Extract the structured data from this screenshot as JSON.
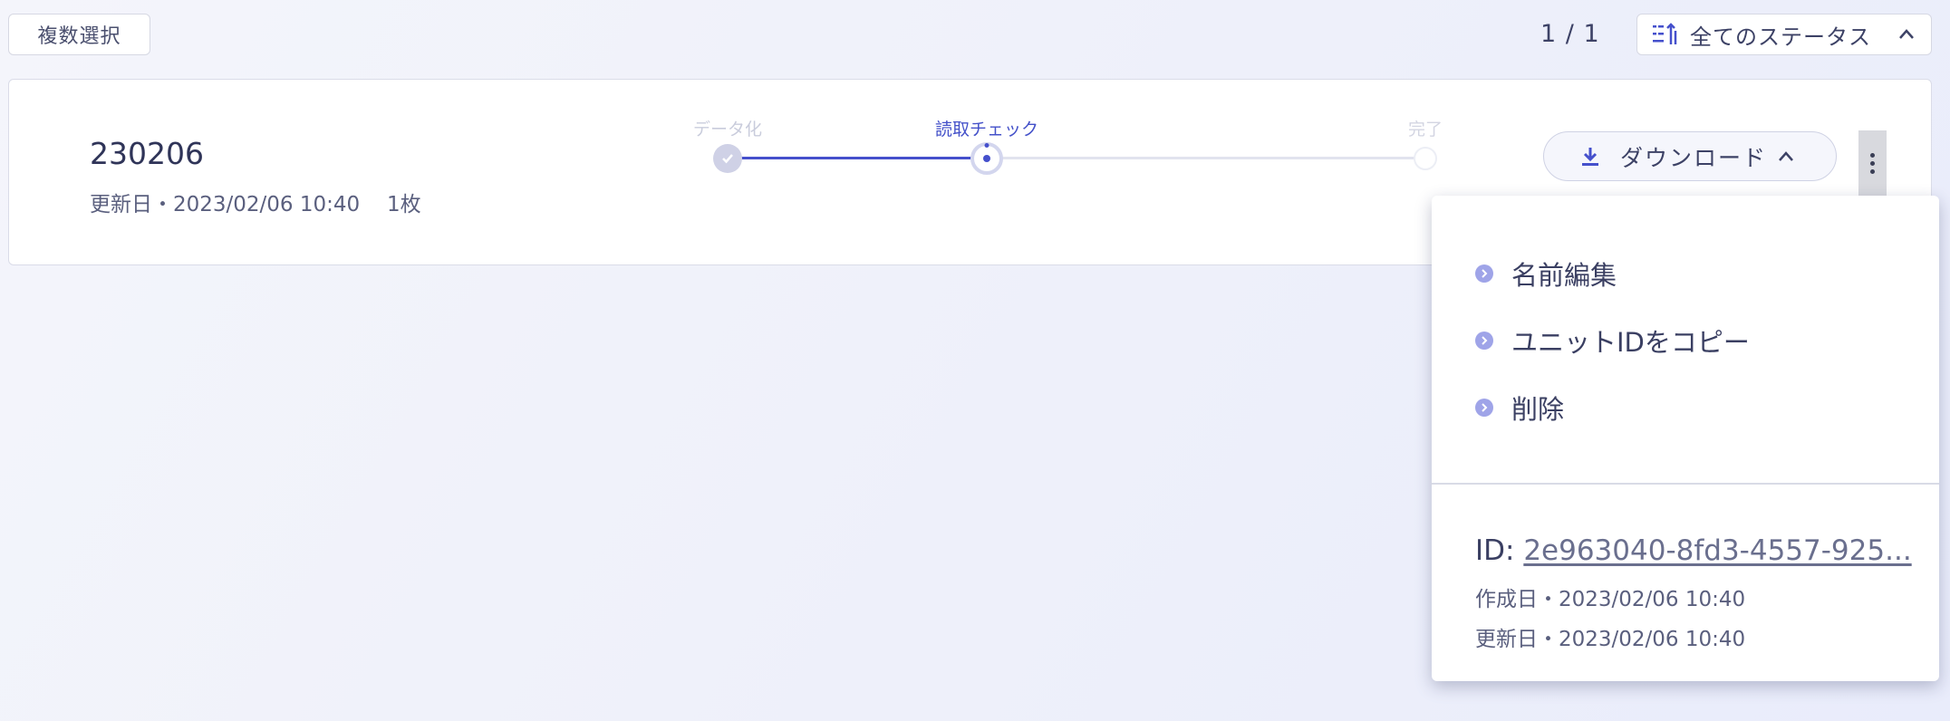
{
  "toolbar": {
    "multi_select_label": "複数選択",
    "pager": "1 / 1",
    "status_filter_label": "全てのステータス"
  },
  "unit": {
    "name": "230206",
    "updated": "更新日・2023/02/06 10:40",
    "count": "1枚",
    "steps": [
      {
        "label": "データ化",
        "state": "done"
      },
      {
        "label": "読取チェック",
        "state": "active"
      },
      {
        "label": "完了",
        "state": "todo"
      }
    ],
    "download_label": "ダウンロード"
  },
  "menu": {
    "items": [
      {
        "label": "名前編集"
      },
      {
        "label": "ユニットIDをコピー"
      },
      {
        "label": "削除"
      }
    ],
    "id_prefix": "ID: ",
    "id_value": "2e963040-8fd3-4557-925...",
    "created": "作成日・2023/02/06 10:40",
    "updated": "更新日・2023/02/06 10:40"
  },
  "colors": {
    "accent": "#4550cc",
    "bullet": "#9fa4e8"
  },
  "icons": {
    "status_filter": "sort-icon",
    "status_chevron": "chevron-up-icon",
    "download": "download-icon",
    "download_chevron": "chevron-up-icon",
    "more": "more-vertical-icon",
    "menu_bullet": "chevron-right-circle-icon",
    "step_done": "check-icon"
  }
}
